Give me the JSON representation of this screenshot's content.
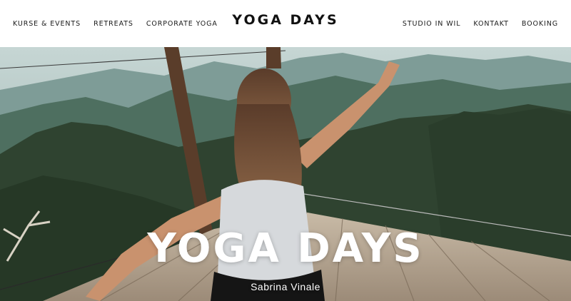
{
  "header": {
    "logo": "YOGA DAYS",
    "nav_left": [
      "KURSE & EVENTS",
      "RETREATS",
      "CORPORATE YOGA"
    ],
    "nav_right": [
      "STUDIO IN WIL",
      "KONTAKT",
      "BOOKING"
    ]
  },
  "hero": {
    "title": "YOGA DAYS",
    "subtitle": "Sabrina Vinale",
    "image_description_icon": "hero-photo",
    "colors": {
      "sky": "#b7cbc9",
      "mountains_far": "#6f8f8b",
      "mountains_mid": "#3f5f52",
      "forest": "#2c3d2a",
      "deck": "#b7a793",
      "text": "#ffffff"
    }
  }
}
